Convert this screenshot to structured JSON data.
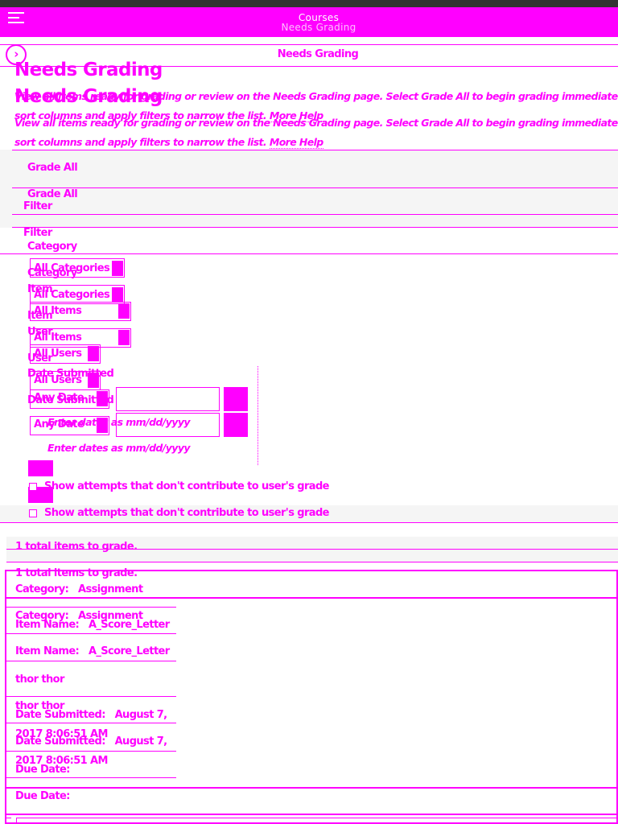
{
  "header": {
    "title": "Courses",
    "subtitle": "Needs Grading",
    "menu_icon": "hamburger-menu-icon",
    "back_icon": "circle-chevron-right-icon"
  },
  "breadcrumb": {
    "label": "Needs Grading"
  },
  "page": {
    "title": "Needs Grading",
    "description": "View all items ready for grading or review on the Needs Grading page. Select Grade All to begin grading immediately, or sort columns and apply filters to narrow the list.",
    "description_line1": "View all items ready for grading or review on the Needs Grading page. Select Grade All to begin grading immediately, or",
    "description_line2": "sort columns and apply filters to narrow the list.",
    "more_help": "More Help"
  },
  "actions": {
    "grade_all": "Grade All"
  },
  "filter": {
    "title": "Filter",
    "category_label": "Category",
    "category_value": "All Categories",
    "item_label": "Item",
    "item_value": "All Items",
    "user_label": "User",
    "user_value": "All Users",
    "date_label": "Date Submitted",
    "date_value": "Any Date",
    "date_hint": "Enter dates as mm/dd/yyyy",
    "show_attempts": "Show attempts that don't contribute to user's grade"
  },
  "results": {
    "total": "1 total items to grade.",
    "item": {
      "category_label": "Category:",
      "category_value": "Assignment",
      "item_name_label": "Item Name:",
      "item_name_value": "A_Score_Letter",
      "user": "thor thor",
      "date_label": "Date Submitted:",
      "date_value_line1": "August 7,",
      "date_value_line2": "2017 8:06:51 AM",
      "due_label": "Due Date:"
    }
  },
  "colors": {
    "accent": "#ff00ff",
    "topbar": "#333333",
    "background": "#ffffff"
  }
}
